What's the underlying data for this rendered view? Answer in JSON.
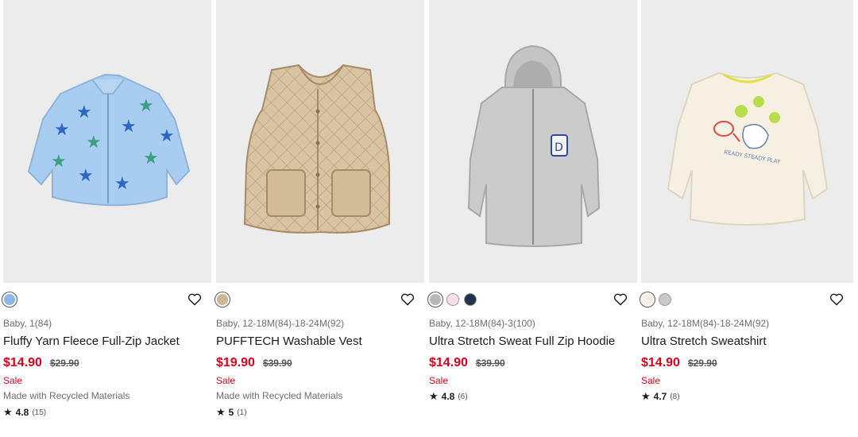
{
  "products": [
    {
      "meta": "Baby, 1(84)",
      "name": "Fluffy Yarn Fleece Full-Zip Jacket",
      "price": "$14.90",
      "original_price": "$29.90",
      "sale_label": "Sale",
      "feature": "Made with Recycled Materials",
      "rating": "4.8",
      "review_count": "(15)",
      "image_icon": "fleece-jacket-icon",
      "swatches": [
        "#8fb7e6"
      ]
    },
    {
      "meta": "Baby, 12-18M(84)-18-24M(92)",
      "name": "PUFFTECH Washable Vest",
      "price": "$19.90",
      "original_price": "$39.90",
      "sale_label": "Sale",
      "feature": "Made with Recycled Materials",
      "rating": "5",
      "review_count": "(1)",
      "image_icon": "quilted-vest-icon",
      "swatches": [
        "#cdb696"
      ]
    },
    {
      "meta": "Baby, 12-18M(84)-3(100)",
      "name": "Ultra Stretch Sweat Full Zip Hoodie",
      "price": "$14.90",
      "original_price": "$39.90",
      "sale_label": "Sale",
      "feature": "",
      "rating": "4.8",
      "review_count": "(6)",
      "image_icon": "zip-hoodie-icon",
      "swatches": [
        "#b8b8b8",
        "#f6dfe6",
        "#223349"
      ]
    },
    {
      "meta": "Baby, 12-18M(84)-18-24M(92)",
      "name": "Ultra Stretch Sweatshirt",
      "price": "$14.90",
      "original_price": "$29.90",
      "sale_label": "Sale",
      "feature": "",
      "rating": "4.7",
      "review_count": "(8)",
      "image_icon": "sweatshirt-icon",
      "swatches": [
        "#f5f0e2",
        "#c9c9c9"
      ]
    }
  ],
  "colors": {
    "sale_red": "#e0001a",
    "image_bg": "#ececec",
    "text_muted": "#6e6e6e"
  }
}
